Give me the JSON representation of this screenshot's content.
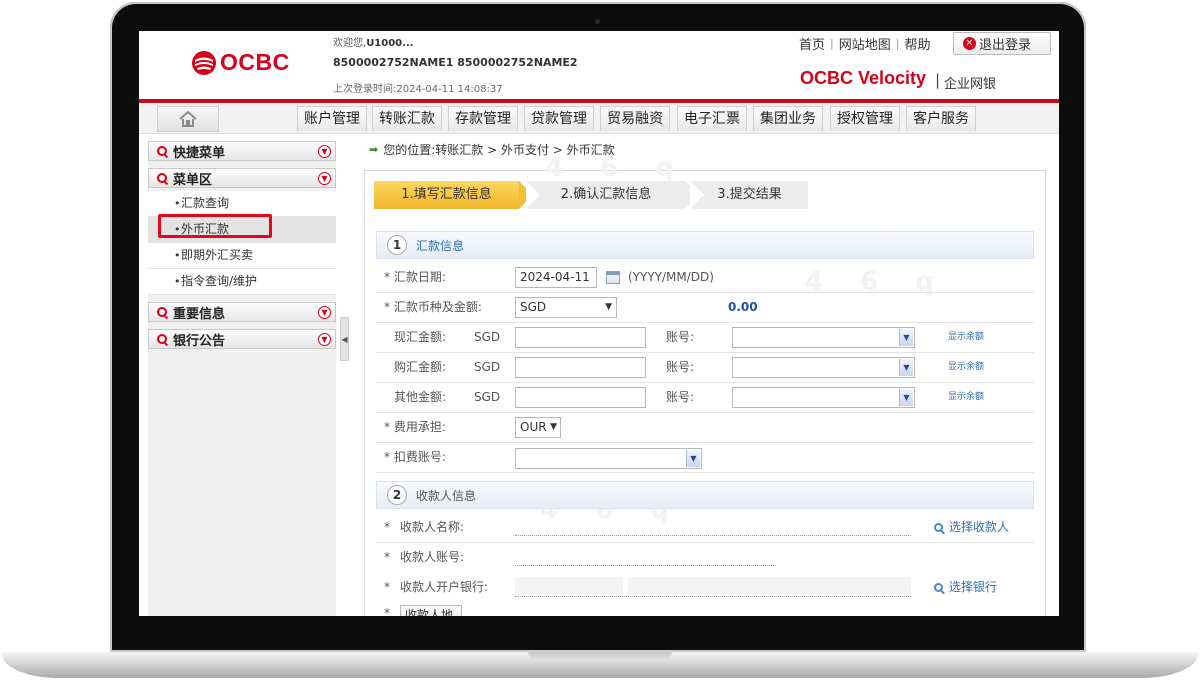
{
  "header": {
    "logo_text": "OCBC",
    "welcome_prefix": "欢迎您,",
    "user": "U1000...",
    "accounts": "8500002752NAME1 8500002752NAME2",
    "last_login": "上次登录时间:2024-04-11 14:08:37",
    "links": [
      "首页",
      "网站地图",
      "帮助"
    ],
    "logout": "退出登录",
    "brand": "OCBC Velocity",
    "brand_sep": "|",
    "brand_sub": "企业网银"
  },
  "nav": {
    "tabs": [
      "账户管理",
      "转账汇款",
      "存款管理",
      "贷款管理",
      "贸易融资",
      "电子汇票",
      "集团业务",
      "授权管理",
      "客户服务"
    ]
  },
  "sidebar": {
    "quick_menu": "快捷菜单",
    "menu_area": "菜单区",
    "items": [
      "汇款查询",
      "外币汇款",
      "即期外汇买卖",
      "指令查询/维护"
    ],
    "important": "重要信息",
    "notice": "银行公告"
  },
  "breadcrumb": "您的位置:转账汇款 > 外币支付 > 外币汇款",
  "steps": [
    "1.填写汇款信息",
    "2.确认汇款信息",
    "3.提交结果"
  ],
  "section1": {
    "num": "1",
    "title": "汇款信息",
    "date_label": "* 汇款日期:",
    "date_value": "2024-04-11",
    "date_format": "(YYYY/MM/DD)",
    "currency_label": "* 汇款币种及金额:",
    "currency_value": "SGD",
    "amount": "0.00",
    "cash_label": "现汇金额:",
    "buy_label": "购汇金额:",
    "other_label": "其他金额:",
    "currency_code": "SGD",
    "account_label": "账号:",
    "show_balance": "显示余额",
    "fee_label": "* 费用承担:",
    "fee_value": "OUR",
    "deduct_label": "* 扣费账号:"
  },
  "section2": {
    "num": "2",
    "title": "收款人信息",
    "star": "*",
    "name_label": "收款人名称:",
    "account_label": "收款人账号:",
    "bank_label": "收款人开户银行:",
    "choose_payee": "选择收款人",
    "choose_bank": "选择银行",
    "address_btn": "收款人地址"
  },
  "watermark": "4 6 q"
}
